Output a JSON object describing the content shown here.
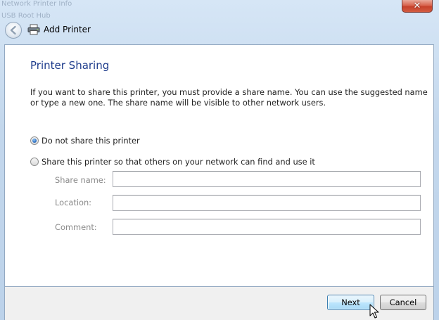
{
  "window": {
    "title": "Add Printer",
    "close_glyph": "✕",
    "back_icon": "back-arrow-icon",
    "title_icon": "printer-icon",
    "background_title_lines": [
      "Network Printer Info",
      "USB Root Hub"
    ]
  },
  "page": {
    "heading": "Printer Sharing",
    "description": "If you want to share this printer, you must provide a share name. You can use the suggested name or type a new one. The share name will be visible to other network users."
  },
  "sharing_options": {
    "no_share": {
      "label": "Do not share this printer",
      "checked": true
    },
    "share": {
      "label": "Share this printer so that others on your network can find and use it",
      "checked": false
    }
  },
  "fields": {
    "share_name": {
      "label": "Share name:",
      "value": ""
    },
    "location": {
      "label": "Location:",
      "value": ""
    },
    "comment": {
      "label": "Comment:",
      "value": ""
    }
  },
  "buttons": {
    "next": "Next",
    "cancel": "Cancel"
  },
  "colors": {
    "heading": "#1e3c8c",
    "close_button": "#c6402b",
    "primary_button_border": "#3c7fb1"
  }
}
